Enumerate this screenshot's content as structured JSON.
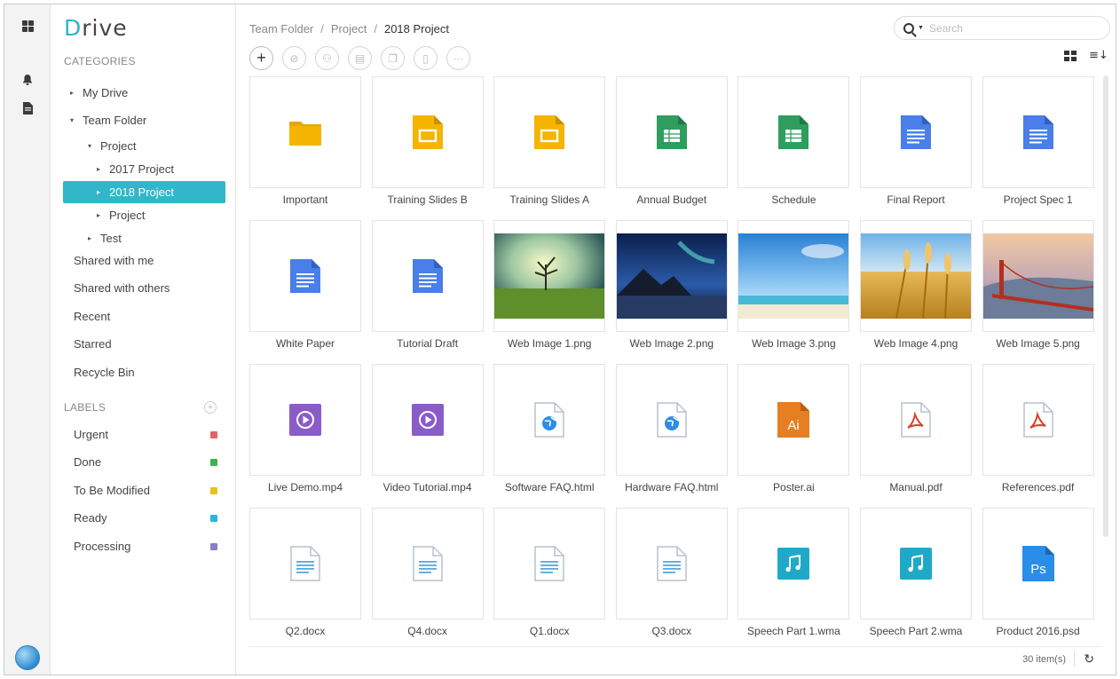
{
  "app": {
    "brand_first": "D",
    "brand_rest": "rive"
  },
  "sidebar": {
    "categories_label": "CATEGORIES",
    "tree": [
      {
        "label": "My Drive",
        "caret": "▸",
        "indent": 0
      },
      {
        "label": "Team Folder",
        "caret": "▾",
        "indent": 0
      },
      {
        "label": "Project",
        "caret": "▾",
        "indent": 1
      },
      {
        "label": "2017 Project",
        "caret": "▸",
        "indent": 2
      },
      {
        "label": "2018 Project",
        "caret": "▸",
        "indent": 2,
        "active": true
      },
      {
        "label": "Project",
        "caret": "▸",
        "indent": 2
      },
      {
        "label": "Test",
        "caret": "▸",
        "indent": 1
      }
    ],
    "nav": [
      "Shared with me",
      "Shared with others",
      "Recent",
      "Starred",
      "Recycle Bin"
    ],
    "labels_label": "LABELS",
    "add_label_symbol": "+",
    "labels": [
      {
        "name": "Urgent",
        "color": "#e06666"
      },
      {
        "name": "Done",
        "color": "#3cb44b"
      },
      {
        "name": "To Be Modified",
        "color": "#e6c21c"
      },
      {
        "name": "Ready",
        "color": "#29b6e0"
      },
      {
        "name": "Processing",
        "color": "#8e7cc3"
      }
    ]
  },
  "breadcrumb": [
    "Team Folder",
    "Project",
    "2018 Project"
  ],
  "breadcrumb_sep": "/",
  "search": {
    "placeholder": "Search"
  },
  "toolbar": {
    "buttons": [
      {
        "icon": "plus-icon",
        "glyph": "+"
      },
      {
        "icon": "tag-icon",
        "glyph": "⊘"
      },
      {
        "icon": "share-user-icon",
        "glyph": "⚇"
      },
      {
        "icon": "move-folder-icon",
        "glyph": "▤"
      },
      {
        "icon": "copy-icon",
        "glyph": "❐"
      },
      {
        "icon": "trash-icon",
        "glyph": "▯"
      },
      {
        "icon": "more-icon",
        "glyph": "···"
      }
    ]
  },
  "files": [
    {
      "name": "Important",
      "type": "folder"
    },
    {
      "name": "Training Slides B",
      "type": "slides"
    },
    {
      "name": "Training Slides A",
      "type": "slides"
    },
    {
      "name": "Annual Budget",
      "type": "sheet"
    },
    {
      "name": "Schedule",
      "type": "sheet"
    },
    {
      "name": "Final Report",
      "type": "doc"
    },
    {
      "name": "Project Spec 1",
      "type": "doc"
    },
    {
      "name": "White Paper",
      "type": "doc"
    },
    {
      "name": "Tutorial Draft",
      "type": "doc"
    },
    {
      "name": "Web Image 1.png",
      "type": "image",
      "scene": "tree-field"
    },
    {
      "name": "Web Image 2.png",
      "type": "image",
      "scene": "aurora-mountain"
    },
    {
      "name": "Web Image 3.png",
      "type": "image",
      "scene": "beach-sky"
    },
    {
      "name": "Web Image 4.png",
      "type": "image",
      "scene": "wheat"
    },
    {
      "name": "Web Image 5.png",
      "type": "image",
      "scene": "bridge"
    },
    {
      "name": "Live Demo.mp4",
      "type": "video"
    },
    {
      "name": "Video Tutorial.mp4",
      "type": "video"
    },
    {
      "name": "Software FAQ.html",
      "type": "html"
    },
    {
      "name": "Hardware FAQ.html",
      "type": "html"
    },
    {
      "name": "Poster.ai",
      "type": "ai",
      "glyph": "Ai"
    },
    {
      "name": "Manual.pdf",
      "type": "pdf"
    },
    {
      "name": "References.pdf",
      "type": "pdf"
    },
    {
      "name": "Q2.docx",
      "type": "docx"
    },
    {
      "name": "Q4.docx",
      "type": "docx"
    },
    {
      "name": "Q1.docx",
      "type": "docx"
    },
    {
      "name": "Q3.docx",
      "type": "docx"
    },
    {
      "name": "Speech Part 1.wma",
      "type": "audio"
    },
    {
      "name": "Speech Part 2.wma",
      "type": "audio"
    },
    {
      "name": "Product 2016.psd",
      "type": "psd",
      "glyph": "Ps"
    }
  ],
  "footer": {
    "count": "30 item(s)",
    "refresh_glyph": "↻"
  },
  "colors": {
    "accent": "#31b7c9",
    "folder": "#f4b400",
    "slides": "#f4b400",
    "sheet": "#2e9d5e",
    "doc": "#4a7ee8",
    "video": "#8a5cc8",
    "ai": "#e67e22",
    "pdf": "#d9402a",
    "audio": "#1fa9c9",
    "psd": "#2a8ee8",
    "docx": "#5aa8d8"
  }
}
